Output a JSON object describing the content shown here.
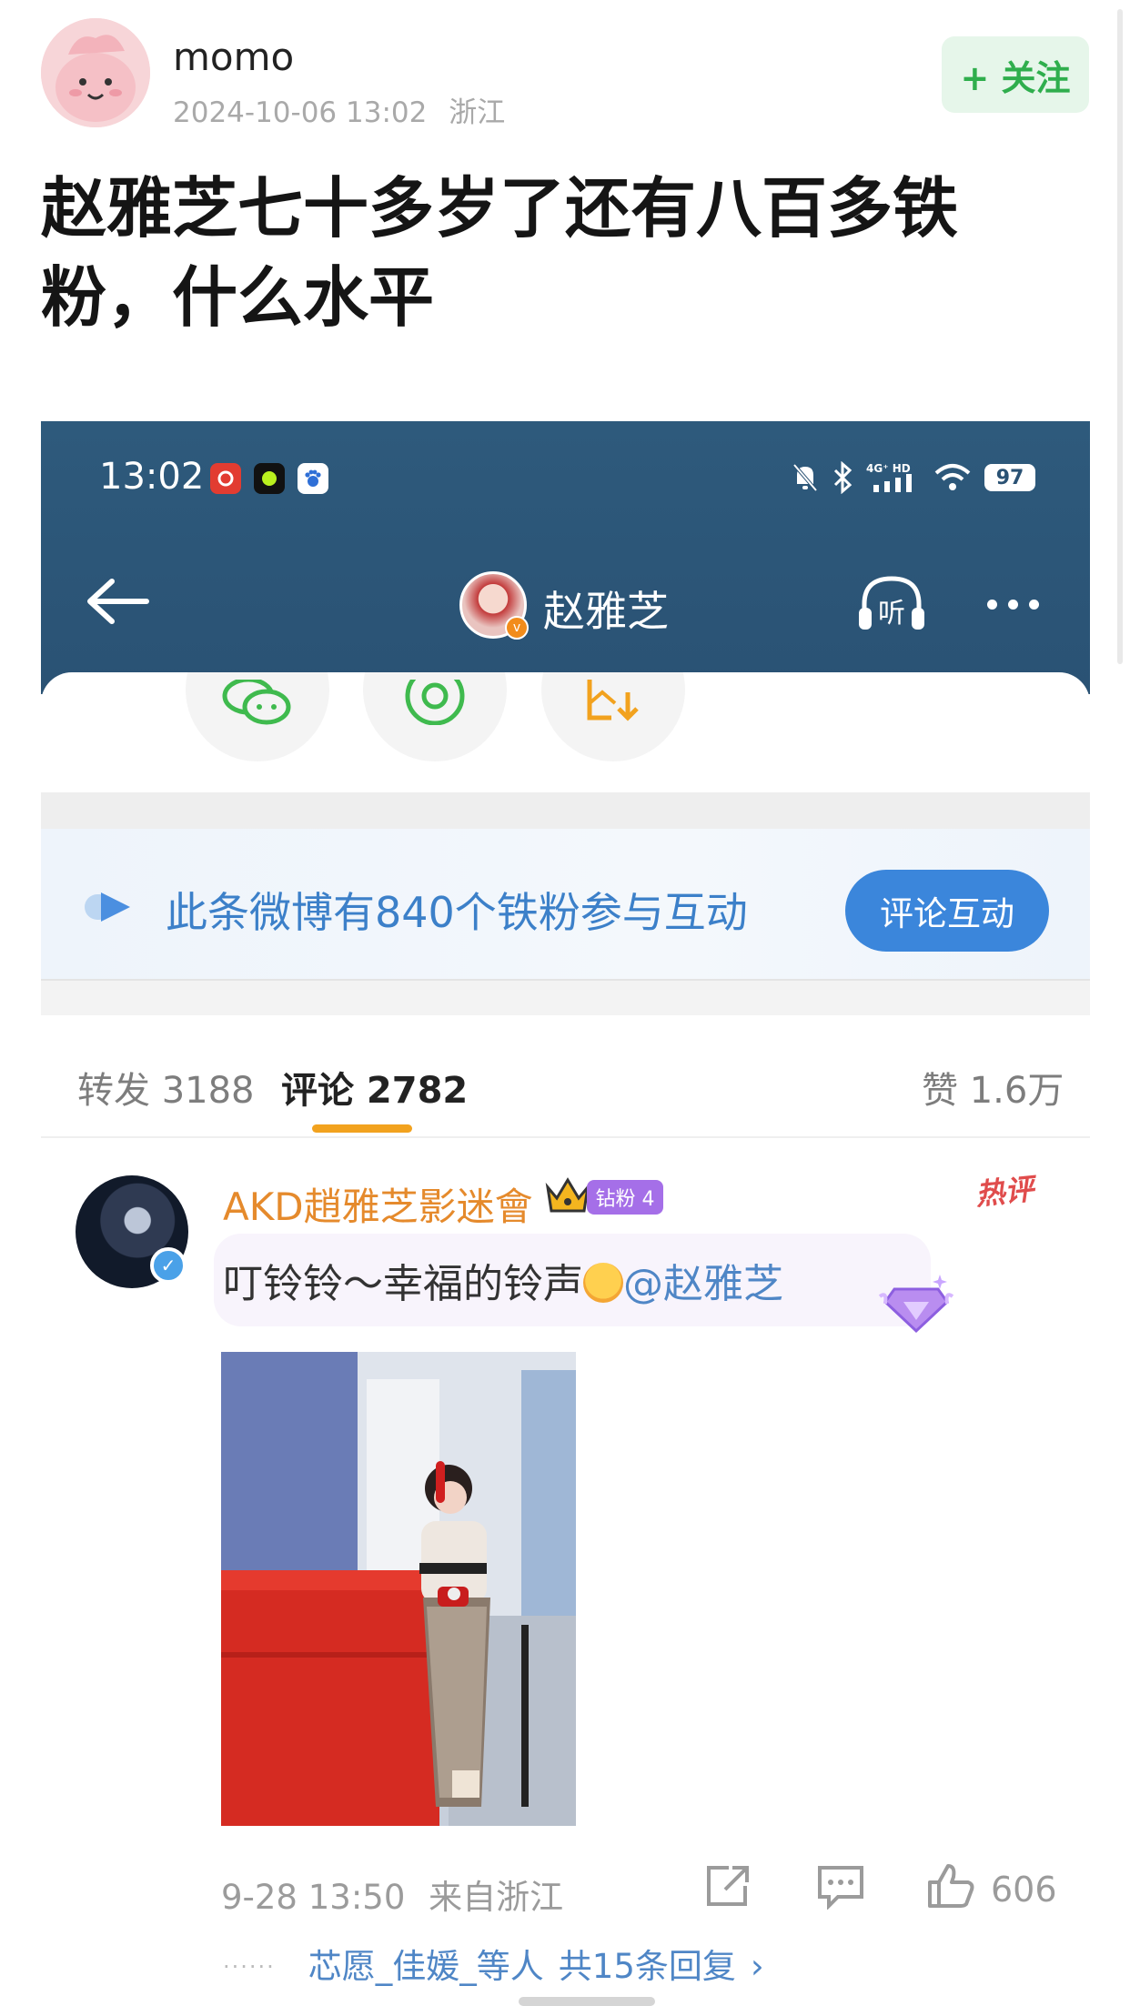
{
  "post": {
    "author": "momo",
    "date": "2024-10-06 13:02",
    "location": "浙江",
    "follow_label": "+ 关注",
    "title": "赵雅芝七十多岁了还有八百多铁粉，什么水平"
  },
  "screenshot": {
    "status_bar": {
      "time": "13:02",
      "network": "4G⁺ HD",
      "battery": "97"
    },
    "nav": {
      "name": "赵雅芝",
      "listen_label": "听"
    },
    "fan_banner": {
      "text": "此条微博有840个铁粉参与互动",
      "button": "评论互动"
    },
    "tabs": {
      "repost": "转发 3188",
      "comments": "评论 2782",
      "likes": "赞 1.6万"
    },
    "comment": {
      "author": "AKD趙雅芝影迷會",
      "fan_badge": "钻粉 4",
      "hot_badge": "热评",
      "text": "叮铃铃～幸福的铃声",
      "mention": "@赵雅芝",
      "date": "9-28 13:50",
      "source": "来自浙江",
      "like_count": "606",
      "reply_users": "芯愿_佳媛_等人",
      "reply_total": "共15条回复",
      "reply_arrow": "›"
    }
  },
  "colors": {
    "header_blue": "#2a5274",
    "follow_green": "#2fae4d",
    "link_blue": "#4f86c6",
    "accent_orange": "#f2a21e",
    "fan_button": "#3b86db"
  },
  "icons": [
    "back-arrow-icon",
    "headphones-icon",
    "more-icon",
    "wechat-icon",
    "moments-icon",
    "save-image-icon",
    "share-icon",
    "comment-icon",
    "like-icon",
    "crown-icon",
    "diamond-icon"
  ]
}
